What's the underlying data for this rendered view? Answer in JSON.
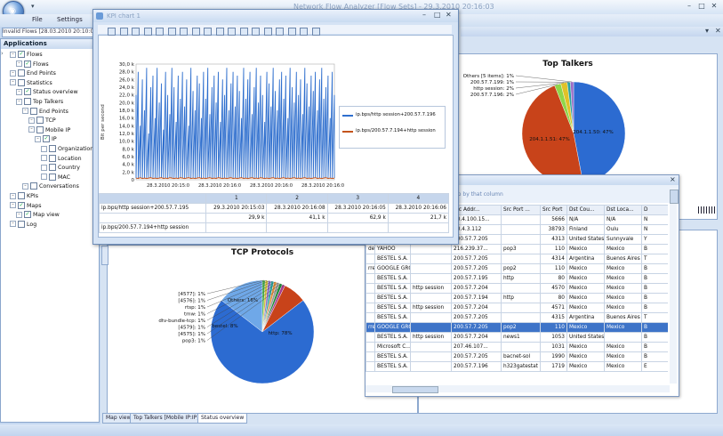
{
  "app": {
    "title": "Network Flow Analyzer [Flow Sets] - 29.3.2010 20:16:03"
  },
  "menu": {
    "file": "File",
    "settings": "Settings"
  },
  "doc_tab": "Invalid Flows [28.03.2010 20:10:03]",
  "sidebar": {
    "header": "Applications",
    "items": [
      {
        "label": "Flows",
        "level": 0,
        "checked": true
      },
      {
        "label": "Flows",
        "level": 1,
        "checked": true
      },
      {
        "label": "End Points",
        "level": 0,
        "checked": false
      },
      {
        "label": "Statistics",
        "level": 0,
        "checked": false
      },
      {
        "label": "Status overview",
        "level": 1,
        "checked": true
      },
      {
        "label": "Top Talkers",
        "level": 1,
        "checked": false
      },
      {
        "label": "End Points",
        "level": 2,
        "checked": false
      },
      {
        "label": "TCP",
        "level": 3,
        "checked": false
      },
      {
        "label": "Mobile IP",
        "level": 3,
        "checked": false
      },
      {
        "label": "IP",
        "level": 4,
        "checked": true
      },
      {
        "label": "Organization",
        "level": 5,
        "checked": false
      },
      {
        "label": "Location",
        "level": 5,
        "checked": false
      },
      {
        "label": "Country",
        "level": 5,
        "checked": false
      },
      {
        "label": "MAC",
        "level": 5,
        "checked": false
      },
      {
        "label": "Conversations",
        "level": 2,
        "checked": false
      },
      {
        "label": "KPIs",
        "level": 0,
        "checked": false
      },
      {
        "label": "Maps",
        "level": 0,
        "checked": true
      },
      {
        "label": "Map view",
        "level": 1,
        "checked": true
      },
      {
        "label": "Log",
        "level": 0,
        "checked": false
      }
    ]
  },
  "kpi_window": {
    "title": "KPI chart 1",
    "y_axis_label": "Bit per second",
    "legend": [
      "ip.bps/http session+200.57.7.196",
      "ip.bps/200.57.7.194+http session"
    ],
    "legend_colors": [
      "#2f6fce",
      "#c4541c"
    ],
    "col_headers": [
      "1",
      "2",
      "3",
      "4"
    ],
    "rows": [
      {
        "name": "ip.bps/http session+200.57.7.195",
        "values": [
          "29.3.2010 20:15:03",
          "28.3.2010 20:16:08",
          "28.3.2010 20:16:05",
          "28.3.2010 20:16:06"
        ]
      },
      {
        "name": "",
        "values": [
          "29,9 k",
          "41,1 k",
          "62,9 k",
          "21,7 k"
        ]
      },
      {
        "name": "ip.bps/200.57.7.194+http session",
        "values": [
          "",
          "",
          "",
          ""
        ]
      }
    ]
  },
  "chart_data": [
    {
      "type": "line",
      "title": "",
      "ylabel": "Bit per second",
      "ylim": [
        0,
        30000
      ],
      "yticks": [
        "0",
        "2,0 k",
        "4,0 k",
        "6,0 k",
        "8,0 k",
        "10,0 k",
        "12,0 k",
        "14,0 k",
        "16,0 k",
        "18,0 k",
        "20,0 k",
        "22,0 k",
        "24,0 k",
        "26,0 k",
        "28,0 k",
        "30,0 k"
      ],
      "xticks": [
        "28.3.2010 20:15:0",
        "28.3.2010 20:16:0",
        "28.3.2010 20:16:0",
        "28.3.2010 20:16:0"
      ],
      "series": [
        {
          "name": "ip.bps/http session+200.57.7.196",
          "values": [
            22,
            28,
            14,
            26,
            18,
            29,
            12,
            24,
            27,
            16,
            29,
            20,
            25,
            13,
            28,
            22,
            17,
            29,
            24,
            15,
            27,
            21,
            28,
            19,
            26,
            14,
            29,
            23,
            18,
            27,
            25,
            16,
            28,
            21,
            29,
            17,
            24,
            27,
            20,
            28,
            15,
            26,
            22,
            29,
            18,
            25,
            28,
            19,
            27,
            23,
            16,
            29,
            21,
            26,
            28,
            17,
            24,
            29,
            20,
            27,
            22,
            15,
            28,
            25,
            19,
            29,
            23,
            18,
            26,
            28,
            21,
            27,
            16,
            29,
            24,
            20,
            28,
            22,
            26,
            17,
            29,
            25,
            19,
            27,
            23,
            28,
            18,
            26,
            29,
            21,
            24,
            27,
            16,
            28,
            22
          ]
        },
        {
          "name": "ip.bps/200.57.7.194+http session",
          "values": [
            0.2,
            0.1,
            0.3,
            0.1,
            0.2,
            0.1,
            0.2,
            0.3,
            0.1,
            0.2,
            0.1,
            0.2,
            0.3,
            0.1,
            0.2,
            0.1,
            0.3,
            0.2,
            0.1,
            0.2,
            0.1,
            0.3,
            0.2,
            0.1,
            0.2,
            0.3,
            0.1,
            0.2,
            0.1,
            0.2,
            0.3,
            0.1,
            0.2,
            0.1,
            0.2,
            0.3,
            0.1,
            0.2,
            0.1,
            0.3,
            0.2,
            0.1,
            0.2,
            0.1,
            0.2,
            0.3,
            0.1,
            0.2,
            0.1,
            0.2,
            0.3,
            0.1,
            0.2,
            0.1,
            0.2,
            0.3,
            0.1,
            0.2,
            0.1,
            0.3,
            0.2,
            0.1,
            0.2,
            0.1,
            0.2,
            0.3,
            0.1,
            0.2,
            0.1,
            0.2,
            0.3,
            0.1,
            0.2,
            0.1,
            0.2,
            0.3,
            0.1,
            0.2,
            0.1,
            0.2,
            0.3,
            0.1,
            0.2,
            0.1,
            0.2,
            0.3,
            0.1,
            0.2,
            0.1,
            0.2,
            0.3,
            0.1,
            0.2,
            0.1,
            0.2
          ]
        }
      ]
    },
    {
      "type": "pie",
      "title": "Top Talkers",
      "slices": [
        {
          "label": "204.1.1.50",
          "value": 47,
          "color": "#2c6bd1"
        },
        {
          "label": "204.1.1.51",
          "value": 47,
          "color": "#c8431a"
        },
        {
          "label": "200.57.7.196",
          "value": 2,
          "color": "#8fd64a"
        },
        {
          "label": "http session",
          "value": 2,
          "color": "#e0c228"
        },
        {
          "label": "200.57.7.199",
          "value": 1,
          "color": "#2ca4a0"
        },
        {
          "label": "Others [5 items]",
          "value": 1,
          "color": "#9b6cc7"
        }
      ],
      "labels": [
        "204.1.1.50: 47%",
        "204.1.1.51: 47%",
        "200.57.7.196: 2%",
        "http session: 2%",
        "200.57.7.199: 1%",
        "Others [5 items]: 1%"
      ]
    },
    {
      "type": "pie",
      "title": "TCP Protocols",
      "slices": [
        {
          "label": "http",
          "value": 78,
          "color": "#2c6bd1"
        },
        {
          "label": "Others",
          "value": 16,
          "color": "#6fa8e8"
        },
        {
          "label": "bestel",
          "value": 8,
          "color": "#c8431a"
        },
        {
          "label": "[4577]",
          "value": 1,
          "color": "#45b24a"
        },
        {
          "label": "[4576]",
          "value": 1,
          "color": "#d6c03a"
        },
        {
          "label": "rtsp",
          "value": 1,
          "color": "#8a6bc4"
        },
        {
          "label": "tmw",
          "value": 1,
          "color": "#2aa3a0"
        },
        {
          "label": "dtv-bundle-tcp",
          "value": 1,
          "color": "#e08f3a"
        },
        {
          "label": "[4579]",
          "value": 1,
          "color": "#999999"
        },
        {
          "label": "[4575]",
          "value": 1,
          "color": "#1f8c3a"
        },
        {
          "label": "pop3",
          "value": 1,
          "color": "#a63a8a"
        }
      ],
      "labels": [
        "[4577]: 1%",
        "[4576]: 1%",
        "rtsp: 1%",
        "tmw: 1%",
        "dtv-bundle-tcp: 1%",
        "[4579]: 1%",
        "[4575]: 1%",
        "pop3: 1%",
        "Others: 16%",
        "bestel: 8%",
        "http: 78%"
      ]
    }
  ],
  "top_talkers": {
    "title": "Top Talkers",
    "close": "×"
  },
  "tcp_protocols": {
    "title": "TCP Protocols"
  },
  "flows_table": {
    "hint": "ip by that column",
    "headers": [
      "Src Addr...",
      "Src Port ...",
      "Src Port",
      "Dst Cou...",
      "Dst Loca...",
      "D"
    ],
    "rows": [
      {
        "left": "",
        "org": "",
        "service": "",
        "addr": "10.4.100.15...",
        "port": "",
        "sport": "5666",
        "country": "N/A",
        "loc": "N/A",
        "d": "N"
      },
      {
        "left": "",
        "org": "",
        "service": "",
        "addr": "10.4.3.112",
        "port": "",
        "sport": "38793",
        "country": "Finland",
        "loc": "Oulu",
        "d": "N"
      },
      {
        "left": "",
        "org": "",
        "service": "",
        "addr": "200.57.7.205",
        "port": "",
        "sport": "4313",
        "country": "United States",
        "loc": "Sunnyvale",
        "d": "Y"
      },
      {
        "left": "de",
        "org": "YAHOO",
        "service": "",
        "addr": "216.239.37...",
        "port": "pop3",
        "sport": "110",
        "country": "Mexico",
        "loc": "Mexico",
        "d": "B"
      },
      {
        "left": "",
        "org": "BESTEL S.A. ...",
        "service": "",
        "addr": "200.57.7.205",
        "port": "",
        "sport": "4314",
        "country": "Argentina",
        "loc": "Buenos Aires",
        "d": "T"
      },
      {
        "left": "rres",
        "org": "GOOGLE GRO...",
        "service": "",
        "addr": "200.57.7.205",
        "port": "pop2",
        "sport": "110",
        "country": "Mexico",
        "loc": "Mexico",
        "d": "B"
      },
      {
        "left": "",
        "org": "BESTEL S.A. ...",
        "service": "",
        "addr": "200.57.7.195",
        "port": "http",
        "sport": "80",
        "country": "Mexico",
        "loc": "Mexico",
        "d": "B"
      },
      {
        "left": "",
        "org": "BESTEL S.A. ...",
        "service": "http session",
        "addr": "200.57.7.204",
        "port": "",
        "sport": "4570",
        "country": "Mexico",
        "loc": "Mexico",
        "d": "B"
      },
      {
        "left": "",
        "org": "BESTEL S.A. ...",
        "service": "",
        "addr": "200.57.7.194",
        "port": "http",
        "sport": "80",
        "country": "Mexico",
        "loc": "Mexico",
        "d": "B"
      },
      {
        "left": "",
        "org": "BESTEL S.A. ...",
        "service": "http session",
        "addr": "200.57.7.204",
        "port": "",
        "sport": "4571",
        "country": "Mexico",
        "loc": "Mexico",
        "d": "B"
      },
      {
        "left": "",
        "org": "BESTEL S.A. ...",
        "service": "",
        "addr": "200.57.7.205",
        "port": "",
        "sport": "4315",
        "country": "Argentina",
        "loc": "Buenos Aires",
        "d": "T"
      },
      {
        "left": "rres",
        "org": "GOOGLE GRO...",
        "service": "",
        "addr": "200.57.7.205",
        "port": "pop2",
        "sport": "110",
        "country": "Mexico",
        "loc": "Mexico",
        "d": "B",
        "selected": true
      },
      {
        "left": "",
        "org": "BESTEL S.A. ...",
        "service": "http session",
        "addr": "200.57.7.204",
        "port": "news1",
        "sport": "1053",
        "country": "United States",
        "loc": "",
        "d": "B"
      },
      {
        "left": "",
        "org": "Microsoft C...",
        "service": "",
        "addr": "207.46.107...",
        "port": "",
        "sport": "1031",
        "country": "Mexico",
        "loc": "Mexico",
        "d": "B"
      },
      {
        "left": "",
        "org": "BESTEL S.A. ...",
        "service": "",
        "addr": "200.57.7.205",
        "port": "bacnet-sol",
        "sport": "1990",
        "country": "Mexico",
        "loc": "Mexico",
        "d": "B"
      },
      {
        "left": "",
        "org": "BESTEL S.A. ...",
        "service": "",
        "addr": "200.57.7.196",
        "port": "h323gatestat",
        "sport": "1719",
        "country": "Mexico",
        "loc": "Mexico",
        "d": "E"
      }
    ]
  },
  "bottom_tabs": [
    "Map view",
    "Top Talkers [Mobile IP:IP]",
    "Status overview"
  ]
}
